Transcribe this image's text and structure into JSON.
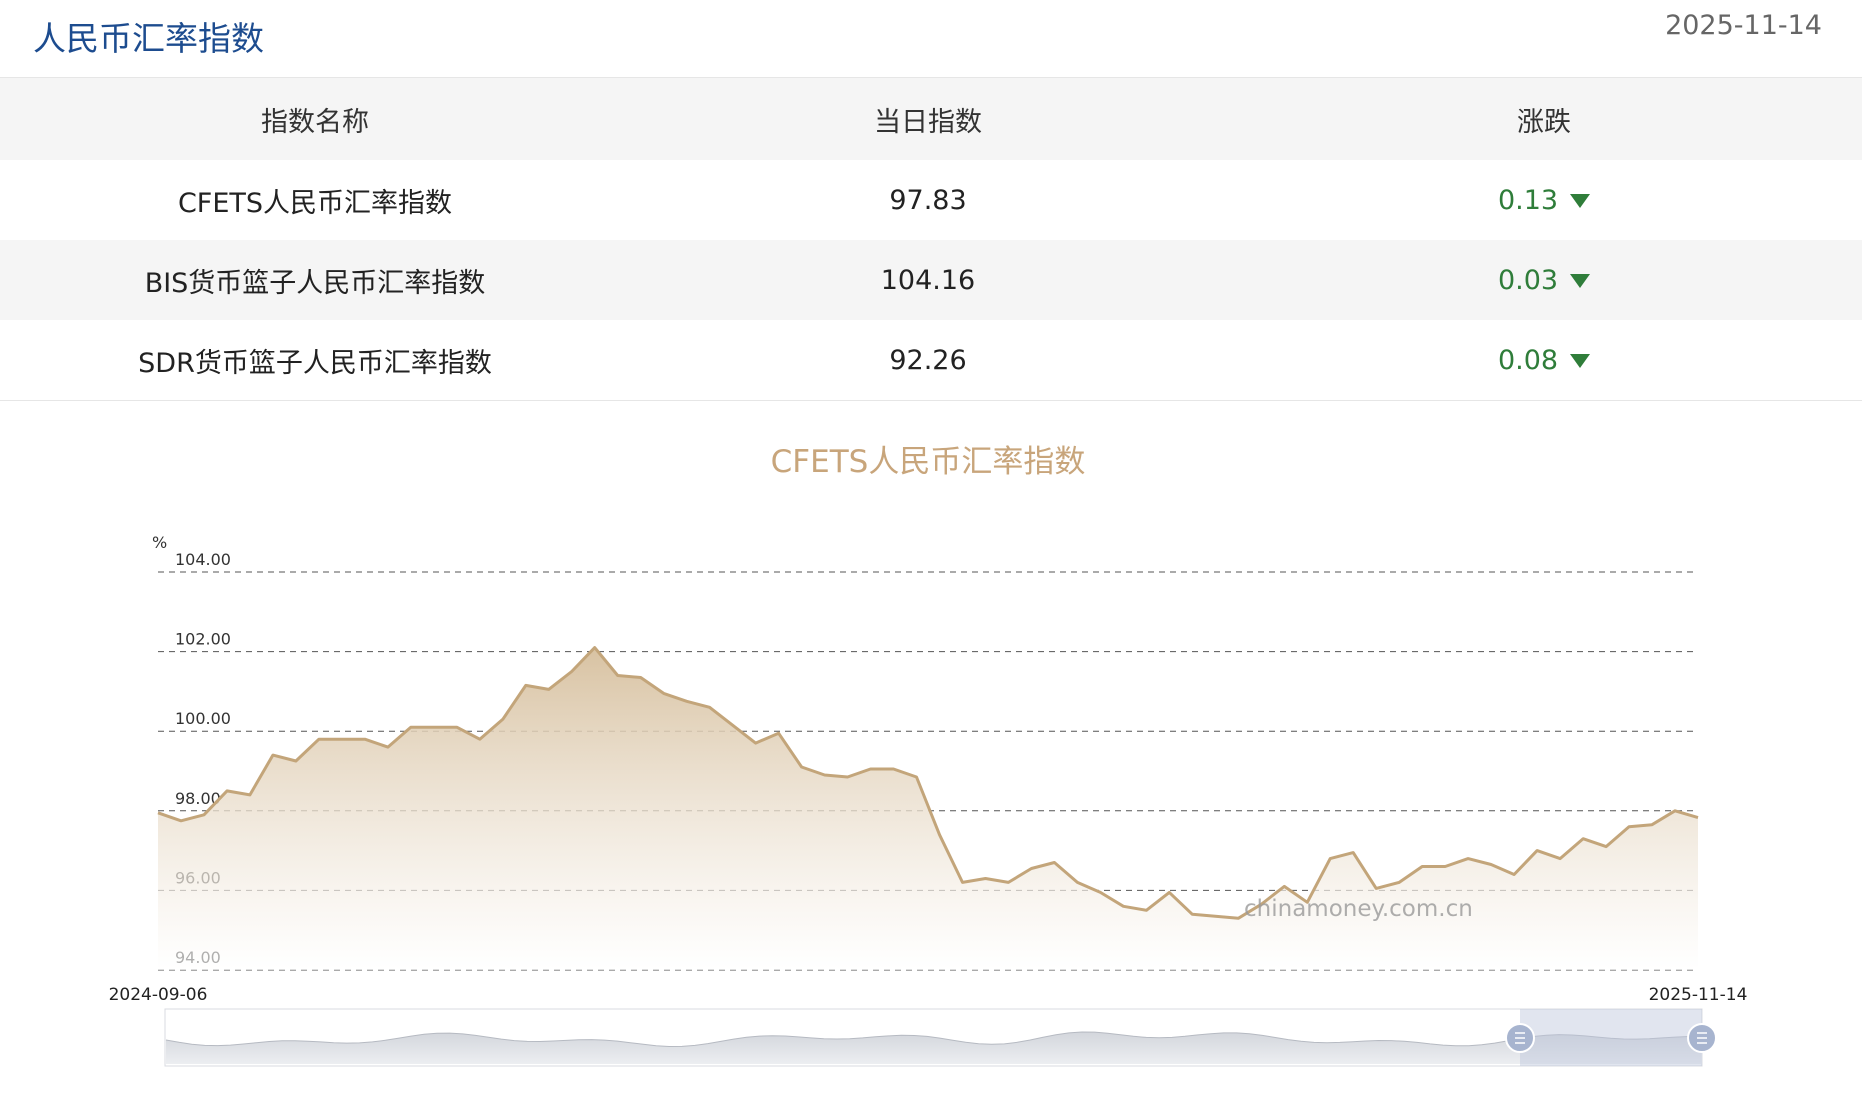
{
  "header": {
    "title": "人民币汇率指数",
    "date": "2025-11-14"
  },
  "table": {
    "columns": [
      "指数名称",
      "当日指数",
      "涨跌"
    ],
    "rows": [
      {
        "name": "CFETS人民币汇率指数",
        "value": "97.83",
        "change": "0.13",
        "direction": "down"
      },
      {
        "name": "BIS货币篮子人民币汇率指数",
        "value": "104.16",
        "change": "0.03",
        "direction": "down"
      },
      {
        "name": "SDR货币篮子人民币汇率指数",
        "value": "92.26",
        "change": "0.08",
        "direction": "down"
      }
    ]
  },
  "colors": {
    "title": "#1d4c8f",
    "down": "#2f7d3a",
    "line": "#c3a57a",
    "chart_title": "#c8a57b"
  },
  "chart_data": {
    "type": "area",
    "title": "CFETS人民币汇率指数",
    "ylabel": "%",
    "ylim": [
      94,
      104
    ],
    "yticks": [
      "94.00",
      "96.00",
      "98.00",
      "100.00",
      "102.00",
      "104.00"
    ],
    "x_start_label": "2024-09-06",
    "x_end_label": "2025-11-14",
    "grid": true,
    "watermark": "chinamoney.com.cn",
    "series": [
      {
        "values": [
          97.95,
          97.75,
          97.9,
          98.5,
          98.4,
          99.4,
          99.25,
          99.8,
          99.8,
          99.8,
          99.6,
          100.1,
          100.1,
          100.1,
          99.8,
          100.3,
          101.15,
          101.05,
          101.5,
          102.1,
          101.4,
          101.35,
          100.95,
          100.75,
          100.6,
          100.15,
          99.7,
          99.95,
          99.1,
          98.9,
          98.85,
          99.05,
          99.05,
          98.85,
          97.4,
          96.2,
          96.3,
          96.2,
          96.55,
          96.7,
          96.2,
          95.95,
          95.6,
          95.5,
          95.95,
          95.4,
          95.35,
          95.3,
          95.65,
          96.1,
          95.7,
          96.8,
          96.95,
          96.05,
          96.2,
          96.6,
          96.6,
          96.8,
          96.65,
          96.4,
          97.0,
          96.8,
          97.3,
          97.1,
          97.6,
          97.65,
          98.0,
          97.83
        ]
      }
    ]
  }
}
